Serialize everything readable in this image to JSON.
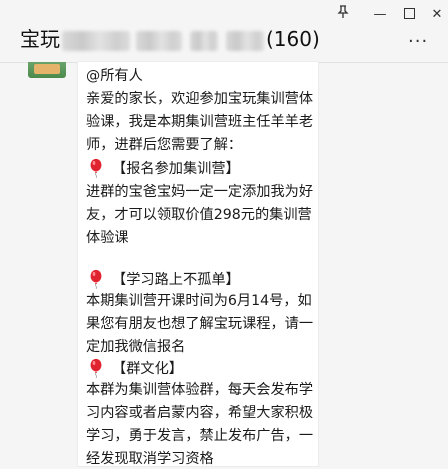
{
  "window": {
    "pin_icon": "pin-icon",
    "minimize_label": "—",
    "close_label": "✕"
  },
  "header": {
    "title_prefix": "宝玩",
    "member_count": "(160)",
    "more_label": "···"
  },
  "message": {
    "lines": [
      "@所有人",
      "亲爱的家长，欢迎参加宝玩集训营体",
      "验课，我是本期集训营班主任羊羊老",
      "师，进群后您需要了解："
    ],
    "sections": [
      {
        "heading": "【报名参加集训营】",
        "lines": [
          "进群的宝爸宝妈一定一定添加我为好",
          "友，才可以领取价值298元的集训营",
          "体验课"
        ]
      },
      {
        "heading": "【学习路上不孤单】",
        "lines": [
          "本期集训营开课时间为6月14号，如",
          "果您有朋友也想了解宝玩课程，请一",
          "定加我微信报名"
        ]
      },
      {
        "heading": "【群文化】",
        "lines": [
          "本群为集训营体验群，每天会发布学",
          "习内容或者启蒙内容，希望大家积极",
          "学习，勇于发言，禁止发布广告，一",
          "经发现取消学习资格"
        ]
      }
    ],
    "accent_color": "#e0242f"
  }
}
